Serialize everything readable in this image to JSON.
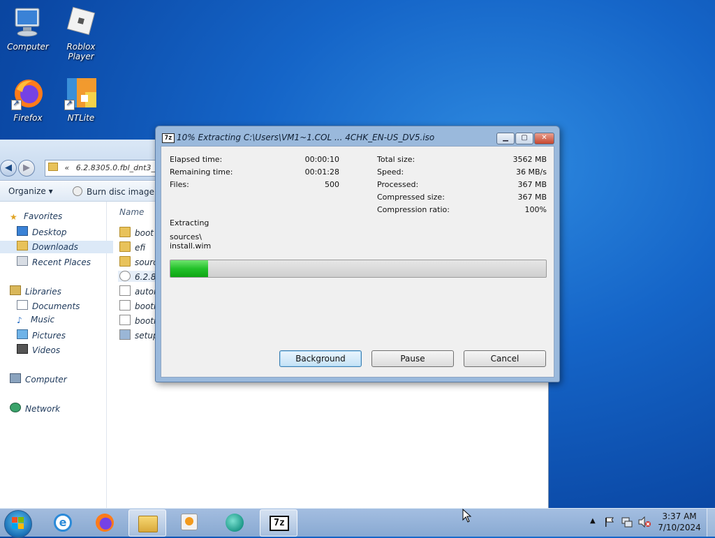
{
  "desktop": {
    "icons": [
      {
        "label": "Computer",
        "icon": "computer-icon"
      },
      {
        "label": "Roblox Player",
        "icon": "roblox-icon"
      },
      {
        "label": "Firefox",
        "icon": "firefox-icon"
      },
      {
        "label": "NTLite",
        "icon": "ntlite-icon"
      }
    ]
  },
  "explorer": {
    "address": "6.2.8305.0.fbl_dnt3_wi",
    "address_prefix": "«",
    "toolbar": {
      "organize": "Organize",
      "burn": "Burn disc image"
    },
    "column_header": "Name",
    "nav": {
      "favorites": "Favorites",
      "desktop": "Desktop",
      "downloads": "Downloads",
      "recent": "Recent Places",
      "libraries": "Libraries",
      "documents": "Documents",
      "music": "Music",
      "pictures": "Pictures",
      "videos": "Videos",
      "computer": "Computer",
      "network": "Network"
    },
    "files": [
      "boot",
      "efi",
      "source",
      "6.2.83",
      "autor",
      "bootm",
      "bootm",
      "setup"
    ]
  },
  "dialog": {
    "title": "10% Extracting C:\\Users\\VM1~1.COL ... 4CHK_EN-US_DV5.iso",
    "logo": "7z",
    "left_stats": [
      {
        "label": "Elapsed time:",
        "value": "00:00:10"
      },
      {
        "label": "Remaining time:",
        "value": "00:01:28"
      },
      {
        "label": "Files:",
        "value": "500"
      }
    ],
    "right_stats": [
      {
        "label": "Total size:",
        "value": "3562 MB"
      },
      {
        "label": "Speed:",
        "value": "36 MB/s"
      },
      {
        "label": "Processed:",
        "value": "367 MB"
      },
      {
        "label": "Compressed size:",
        "value": "367 MB"
      },
      {
        "label": "Compression ratio:",
        "value": "100%"
      }
    ],
    "status": "Extracting",
    "current_dir": "sources\\",
    "current_file": "install.wim",
    "progress_fraction": 0.1,
    "progress_color": "#23c12a",
    "buttons": {
      "background": "Background",
      "pause": "Pause",
      "cancel": "Cancel"
    }
  },
  "taskbar": {
    "time": "3:37 AM",
    "date": "7/10/2024",
    "apps": [
      "internet-explorer-icon",
      "firefox-icon",
      "file-explorer-icon",
      "media-player-icon",
      "app-icon",
      "7zip-icon"
    ],
    "active_app": "7zip-icon"
  },
  "colors": {
    "desktop": "#1565c8",
    "accent": "#3c7fb1"
  }
}
